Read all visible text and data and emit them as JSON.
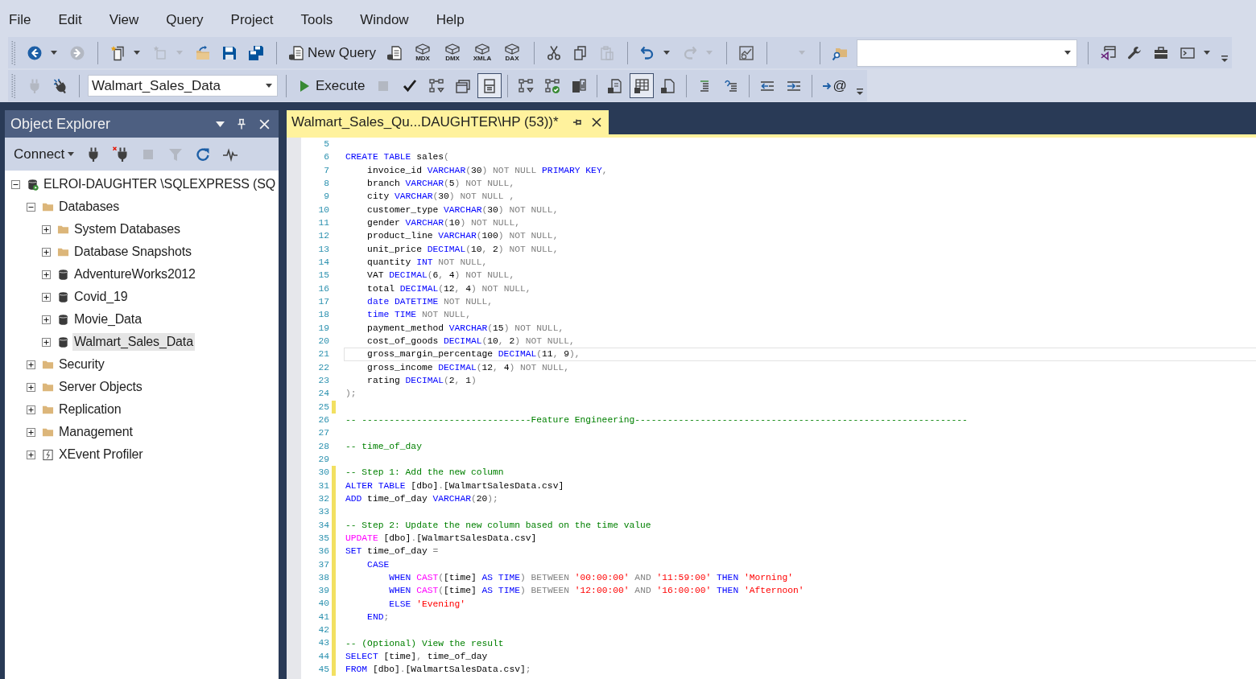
{
  "menu": [
    "File",
    "Edit",
    "View",
    "Query",
    "Project",
    "Tools",
    "Window",
    "Help"
  ],
  "toolbars": [
    {
      "items": [
        {
          "kind": "grip"
        },
        {
          "kind": "button",
          "disabled": false,
          "dropdown": true
        },
        {
          "kind": "button",
          "disabled": true,
          "dropdown": false
        },
        {
          "kind": "separator"
        },
        {
          "kind": "button",
          "disabled": false,
          "dropdown": true
        },
        {
          "kind": "button",
          "disabled": true,
          "dropdown": true
        },
        {
          "kind": "button",
          "disabled": false,
          "dropdown": false
        },
        {
          "kind": "button",
          "disabled": false,
          "dropdown": false
        },
        {
          "kind": "button",
          "disabled": false,
          "dropdown": false
        },
        {
          "kind": "separator"
        },
        {
          "kind": "text-button",
          "label": "New Query"
        },
        {
          "kind": "button",
          "disabled": false,
          "dropdown": false
        },
        {
          "kind": "button",
          "label": "MDX",
          "disabled": false,
          "dropdown": false
        },
        {
          "kind": "button",
          "label": "DMX",
          "disabled": false,
          "dropdown": false
        },
        {
          "kind": "button",
          "label": "XMLA",
          "disabled": false,
          "dropdown": false
        },
        {
          "kind": "button",
          "label": "DAX",
          "disabled": false,
          "dropdown": false
        },
        {
          "kind": "separator"
        },
        {
          "kind": "button",
          "disabled": false,
          "dropdown": false
        },
        {
          "kind": "button",
          "disabled": false,
          "dropdown": false
        },
        {
          "kind": "button",
          "disabled": true,
          "dropdown": false
        },
        {
          "kind": "separator"
        },
        {
          "kind": "button",
          "disabled": false,
          "dropdown": true
        },
        {
          "kind": "button",
          "disabled": true,
          "dropdown": true
        },
        {
          "kind": "separator"
        },
        {
          "kind": "button",
          "disabled": false,
          "dropdown": false
        },
        {
          "kind": "separator"
        },
        {
          "kind": "config-dropdown",
          "disabled": true
        },
        {
          "kind": "separator"
        },
        {
          "kind": "button",
          "disabled": false,
          "dropdown": false
        },
        {
          "kind": "search-combo"
        },
        {
          "kind": "separator"
        },
        {
          "kind": "button",
          "disabled": false,
          "dropdown": false
        },
        {
          "kind": "button",
          "disabled": false,
          "dropdown": false
        },
        {
          "kind": "button",
          "disabled": false,
          "dropdown": false
        },
        {
          "kind": "button",
          "disabled": false,
          "dropdown": true
        },
        {
          "kind": "overflow"
        }
      ]
    },
    {
      "items": [
        {
          "kind": "grip"
        },
        {
          "kind": "button",
          "disabled": true,
          "pressed": false
        },
        {
          "kind": "button",
          "disabled": false,
          "pressed": false
        },
        {
          "kind": "separator"
        },
        {
          "kind": "database-combo",
          "value": "Walmart_Sales_Data"
        },
        {
          "kind": "separator"
        },
        {
          "kind": "text-button",
          "label": "Execute"
        },
        {
          "kind": "button",
          "disabled": true,
          "pressed": false
        },
        {
          "kind": "button",
          "disabled": false,
          "pressed": false
        },
        {
          "kind": "button",
          "disabled": false,
          "pressed": false
        },
        {
          "kind": "button",
          "disabled": false,
          "pressed": false
        },
        {
          "kind": "button",
          "disabled": false,
          "pressed": true
        },
        {
          "kind": "separator"
        },
        {
          "kind": "button",
          "disabled": false,
          "pressed": false
        },
        {
          "kind": "button",
          "disabled": false,
          "pressed": false
        },
        {
          "kind": "button",
          "disabled": false,
          "pressed": false
        },
        {
          "kind": "separator"
        },
        {
          "kind": "button",
          "disabled": false,
          "pressed": false
        },
        {
          "kind": "button",
          "disabled": false,
          "pressed": true
        },
        {
          "kind": "button",
          "disabled": false,
          "pressed": false
        },
        {
          "kind": "separator"
        },
        {
          "kind": "button",
          "disabled": false,
          "pressed": false
        },
        {
          "kind": "button",
          "disabled": false,
          "pressed": false
        },
        {
          "kind": "separator"
        },
        {
          "kind": "button",
          "disabled": false,
          "pressed": false
        },
        {
          "kind": "button",
          "disabled": false,
          "pressed": false
        },
        {
          "kind": "separator"
        },
        {
          "kind": "button",
          "label": "@",
          "disabled": false,
          "pressed": false
        },
        {
          "kind": "overflow"
        }
      ]
    }
  ],
  "object_explorer": {
    "title": "Object Explorer",
    "toolbar": [
      {
        "kind": "connect",
        "label": "Connect"
      },
      {
        "kind": "button",
        "disabled": false
      },
      {
        "kind": "button",
        "disabled": false
      },
      {
        "kind": "button",
        "disabled": true
      },
      {
        "kind": "button",
        "disabled": true
      },
      {
        "kind": "button",
        "disabled": false
      },
      {
        "kind": "button",
        "disabled": false
      }
    ],
    "tree": [
      {
        "label": "ELROI-DAUGHTER \\SQLEXPRESS (SQ",
        "kind": "server",
        "expanded": true,
        "selected": false,
        "children": [
          {
            "label": "Databases",
            "kind": "folder",
            "expanded": true,
            "selected": false,
            "children": [
              {
                "label": "System Databases",
                "kind": "folder",
                "expanded": false,
                "selected": false
              },
              {
                "label": "Database Snapshots",
                "kind": "folder",
                "expanded": false,
                "selected": false
              },
              {
                "label": "AdventureWorks2012",
                "kind": "database",
                "expanded": false,
                "selected": false
              },
              {
                "label": "Covid_19",
                "kind": "database",
                "expanded": false,
                "selected": false
              },
              {
                "label": "Movie_Data",
                "kind": "database",
                "expanded": false,
                "selected": false
              },
              {
                "label": "Walmart_Sales_Data",
                "kind": "database",
                "expanded": false,
                "selected": true
              }
            ]
          },
          {
            "label": "Security",
            "kind": "folder",
            "expanded": false,
            "selected": false
          },
          {
            "label": "Server Objects",
            "kind": "folder",
            "expanded": false,
            "selected": false
          },
          {
            "label": "Replication",
            "kind": "folder",
            "expanded": false,
            "selected": false
          },
          {
            "label": "Management",
            "kind": "folder",
            "expanded": false,
            "selected": false
          },
          {
            "label": "XEvent Profiler",
            "kind": "profiler",
            "expanded": false,
            "selected": false
          }
        ]
      }
    ]
  },
  "editor": {
    "tabs": [
      {
        "label": "Walmart_Sales_Qu...DAUGHTER\\HP (53))*",
        "selected": true
      }
    ],
    "lines": [
      {
        "number": "5",
        "changed": false,
        "current": false
      },
      {
        "number": "6",
        "changed": false,
        "current": false,
        "tokens": [
          {
            "kind": "keyword",
            "text": "CREATE TABLE"
          },
          {
            "kind": "identifier",
            "text": " sales"
          },
          {
            "kind": "operator",
            "text": "("
          }
        ]
      },
      {
        "number": "7",
        "changed": false,
        "current": false,
        "tokens": [
          {
            "kind": "identifier",
            "text": "    invoice_id "
          },
          {
            "kind": "keyword",
            "text": "VARCHAR"
          },
          {
            "kind": "operator",
            "text": "("
          },
          {
            "kind": "identifier",
            "text": "30"
          },
          {
            "kind": "operator",
            "text": ") NOT NULL "
          },
          {
            "kind": "keyword",
            "text": "PRIMARY KEY"
          },
          {
            "kind": "operator",
            "text": ","
          }
        ]
      },
      {
        "number": "8",
        "changed": false,
        "current": false,
        "tokens": [
          {
            "kind": "identifier",
            "text": "    branch "
          },
          {
            "kind": "keyword",
            "text": "VARCHAR"
          },
          {
            "kind": "operator",
            "text": "("
          },
          {
            "kind": "identifier",
            "text": "5"
          },
          {
            "kind": "operator",
            "text": ") NOT NULL,"
          }
        ]
      },
      {
        "number": "9",
        "changed": false,
        "current": false,
        "tokens": [
          {
            "kind": "identifier",
            "text": "    city "
          },
          {
            "kind": "keyword",
            "text": "VARCHAR"
          },
          {
            "kind": "operator",
            "text": "("
          },
          {
            "kind": "identifier",
            "text": "30"
          },
          {
            "kind": "operator",
            "text": ") NOT NULL ,"
          }
        ]
      },
      {
        "number": "10",
        "changed": false,
        "current": false,
        "tokens": [
          {
            "kind": "identifier",
            "text": "    customer_type "
          },
          {
            "kind": "keyword",
            "text": "VARCHAR"
          },
          {
            "kind": "operator",
            "text": "("
          },
          {
            "kind": "identifier",
            "text": "30"
          },
          {
            "kind": "operator",
            "text": ") NOT NULL,"
          }
        ]
      },
      {
        "number": "11",
        "changed": false,
        "current": false,
        "tokens": [
          {
            "kind": "identifier",
            "text": "    gender "
          },
          {
            "kind": "keyword",
            "text": "VARCHAR"
          },
          {
            "kind": "operator",
            "text": "("
          },
          {
            "kind": "identifier",
            "text": "10"
          },
          {
            "kind": "operator",
            "text": ") NOT NULL,"
          }
        ]
      },
      {
        "number": "12",
        "changed": false,
        "current": false,
        "tokens": [
          {
            "kind": "identifier",
            "text": "    product_line "
          },
          {
            "kind": "keyword",
            "text": "VARCHAR"
          },
          {
            "kind": "operator",
            "text": "("
          },
          {
            "kind": "identifier",
            "text": "100"
          },
          {
            "kind": "operator",
            "text": ") NOT NULL,"
          }
        ]
      },
      {
        "number": "13",
        "changed": false,
        "current": false,
        "tokens": [
          {
            "kind": "identifier",
            "text": "    unit_price "
          },
          {
            "kind": "keyword",
            "text": "DECIMAL"
          },
          {
            "kind": "operator",
            "text": "("
          },
          {
            "kind": "identifier",
            "text": "10"
          },
          {
            "kind": "operator",
            "text": ", "
          },
          {
            "kind": "identifier",
            "text": "2"
          },
          {
            "kind": "operator",
            "text": ") NOT NULL,"
          }
        ]
      },
      {
        "number": "14",
        "changed": false,
        "current": false,
        "tokens": [
          {
            "kind": "identifier",
            "text": "    quantity "
          },
          {
            "kind": "keyword",
            "text": "INT"
          },
          {
            "kind": "operator",
            "text": " NOT NULL,"
          }
        ]
      },
      {
        "number": "15",
        "changed": false,
        "current": false,
        "tokens": [
          {
            "kind": "identifier",
            "text": "    VAT "
          },
          {
            "kind": "keyword",
            "text": "DECIMAL"
          },
          {
            "kind": "operator",
            "text": "("
          },
          {
            "kind": "identifier",
            "text": "6"
          },
          {
            "kind": "operator",
            "text": ", "
          },
          {
            "kind": "identifier",
            "text": "4"
          },
          {
            "kind": "operator",
            "text": ") NOT NULL,"
          }
        ]
      },
      {
        "number": "16",
        "changed": false,
        "current": false,
        "tokens": [
          {
            "kind": "identifier",
            "text": "    total "
          },
          {
            "kind": "keyword",
            "text": "DECIMAL"
          },
          {
            "kind": "operator",
            "text": "("
          },
          {
            "kind": "identifier",
            "text": "12"
          },
          {
            "kind": "operator",
            "text": ", "
          },
          {
            "kind": "identifier",
            "text": "4"
          },
          {
            "kind": "operator",
            "text": ") NOT NULL,"
          }
        ]
      },
      {
        "number": "17",
        "changed": false,
        "current": false,
        "tokens": [
          {
            "kind": "keyword",
            "text": "    date DATETIME"
          },
          {
            "kind": "operator",
            "text": " NOT NULL,"
          }
        ]
      },
      {
        "number": "18",
        "changed": false,
        "current": false,
        "tokens": [
          {
            "kind": "keyword",
            "text": "    time TIME"
          },
          {
            "kind": "operator",
            "text": " NOT NULL,"
          }
        ]
      },
      {
        "number": "19",
        "changed": false,
        "current": false,
        "tokens": [
          {
            "kind": "identifier",
            "text": "    payment_method "
          },
          {
            "kind": "keyword",
            "text": "VARCHAR"
          },
          {
            "kind": "operator",
            "text": "("
          },
          {
            "kind": "identifier",
            "text": "15"
          },
          {
            "kind": "operator",
            "text": ") NOT NULL,"
          }
        ]
      },
      {
        "number": "20",
        "changed": false,
        "current": false,
        "tokens": [
          {
            "kind": "identifier",
            "text": "    cost_of_goods "
          },
          {
            "kind": "keyword",
            "text": "DECIMAL"
          },
          {
            "kind": "operator",
            "text": "("
          },
          {
            "kind": "identifier",
            "text": "10"
          },
          {
            "kind": "operator",
            "text": ", "
          },
          {
            "kind": "identifier",
            "text": "2"
          },
          {
            "kind": "operator",
            "text": ") NOT NULL,"
          }
        ]
      },
      {
        "number": "21",
        "changed": false,
        "current": true,
        "tokens": [
          {
            "kind": "identifier",
            "text": "    gross_margin_percentage "
          },
          {
            "kind": "keyword",
            "text": "DECIMAL"
          },
          {
            "kind": "operator",
            "text": "("
          },
          {
            "kind": "identifier",
            "text": "11"
          },
          {
            "kind": "operator",
            "text": ", "
          },
          {
            "kind": "identifier",
            "text": "9"
          },
          {
            "kind": "operator",
            "text": "),"
          }
        ]
      },
      {
        "number": "22",
        "changed": false,
        "current": false,
        "tokens": [
          {
            "kind": "identifier",
            "text": "    gross_income "
          },
          {
            "kind": "keyword",
            "text": "DECIMAL"
          },
          {
            "kind": "operator",
            "text": "("
          },
          {
            "kind": "identifier",
            "text": "12"
          },
          {
            "kind": "operator",
            "text": ", "
          },
          {
            "kind": "identifier",
            "text": "4"
          },
          {
            "kind": "operator",
            "text": ") NOT NULL,"
          }
        ]
      },
      {
        "number": "23",
        "changed": false,
        "current": false,
        "tokens": [
          {
            "kind": "identifier",
            "text": "    rating "
          },
          {
            "kind": "keyword",
            "text": "DECIMAL"
          },
          {
            "kind": "operator",
            "text": "("
          },
          {
            "kind": "identifier",
            "text": "2"
          },
          {
            "kind": "operator",
            "text": ", "
          },
          {
            "kind": "identifier",
            "text": "1"
          },
          {
            "kind": "operator",
            "text": ")"
          }
        ]
      },
      {
        "number": "24",
        "changed": false,
        "current": false,
        "tokens": [
          {
            "kind": "operator",
            "text": ");"
          }
        ]
      },
      {
        "number": "25",
        "changed": true,
        "current": false
      },
      {
        "number": "26",
        "changed": false,
        "current": false,
        "tokens": [
          {
            "kind": "comment",
            "text": "-- -------------------------------Feature Engineering-------------------------------------------------------------"
          }
        ]
      },
      {
        "number": "27",
        "changed": false,
        "current": false
      },
      {
        "number": "28",
        "changed": false,
        "current": false,
        "tokens": [
          {
            "kind": "comment",
            "text": "-- time_of_day"
          }
        ]
      },
      {
        "number": "29",
        "changed": false,
        "current": false
      },
      {
        "number": "30",
        "changed": true,
        "current": false,
        "tokens": [
          {
            "kind": "comment",
            "text": "-- Step 1: Add the new column"
          }
        ]
      },
      {
        "number": "31",
        "changed": true,
        "current": false,
        "tokens": [
          {
            "kind": "keyword",
            "text": "ALTER TABLE"
          },
          {
            "kind": "identifier",
            "text": " [dbo]"
          },
          {
            "kind": "operator",
            "text": "."
          },
          {
            "kind": "identifier",
            "text": "[WalmartSalesData.csv]"
          }
        ]
      },
      {
        "number": "32",
        "changed": true,
        "current": false,
        "tokens": [
          {
            "kind": "keyword",
            "text": "ADD"
          },
          {
            "kind": "identifier",
            "text": " time_of_day "
          },
          {
            "kind": "keyword",
            "text": "VARCHAR"
          },
          {
            "kind": "operator",
            "text": "("
          },
          {
            "kind": "identifier",
            "text": "20"
          },
          {
            "kind": "operator",
            "text": ");"
          }
        ]
      },
      {
        "number": "33",
        "changed": true,
        "current": false
      },
      {
        "number": "34",
        "changed": true,
        "current": false,
        "tokens": [
          {
            "kind": "comment",
            "text": "-- Step 2: Update the new column based on the time value"
          }
        ]
      },
      {
        "number": "35",
        "changed": true,
        "current": false,
        "tokens": [
          {
            "kind": "function",
            "text": "UPDATE"
          },
          {
            "kind": "identifier",
            "text": " [dbo]"
          },
          {
            "kind": "operator",
            "text": "."
          },
          {
            "kind": "identifier",
            "text": "[WalmartSalesData.csv]"
          }
        ]
      },
      {
        "number": "36",
        "changed": true,
        "current": false,
        "tokens": [
          {
            "kind": "keyword",
            "text": "SET"
          },
          {
            "kind": "identifier",
            "text": " time_of_day "
          },
          {
            "kind": "operator",
            "text": "="
          }
        ]
      },
      {
        "number": "37",
        "changed": true,
        "current": false,
        "tokens": [
          {
            "kind": "keyword",
            "text": "    CASE"
          }
        ]
      },
      {
        "number": "38",
        "changed": true,
        "current": false,
        "tokens": [
          {
            "kind": "keyword",
            "text": "        WHEN "
          },
          {
            "kind": "function",
            "text": "CAST"
          },
          {
            "kind": "operator",
            "text": "("
          },
          {
            "kind": "identifier",
            "text": "[time] "
          },
          {
            "kind": "keyword",
            "text": "AS TIME"
          },
          {
            "kind": "operator",
            "text": ") BETWEEN "
          },
          {
            "kind": "string",
            "text": "'00:00:00'"
          },
          {
            "kind": "operator",
            "text": " AND "
          },
          {
            "kind": "string",
            "text": "'11:59:00'"
          },
          {
            "kind": "keyword",
            "text": " THEN "
          },
          {
            "kind": "string",
            "text": "'Morning'"
          }
        ]
      },
      {
        "number": "39",
        "changed": true,
        "current": false,
        "tokens": [
          {
            "kind": "keyword",
            "text": "        WHEN "
          },
          {
            "kind": "function",
            "text": "CAST"
          },
          {
            "kind": "operator",
            "text": "("
          },
          {
            "kind": "identifier",
            "text": "[time] "
          },
          {
            "kind": "keyword",
            "text": "AS TIME"
          },
          {
            "kind": "operator",
            "text": ") BETWEEN "
          },
          {
            "kind": "string",
            "text": "'12:00:00'"
          },
          {
            "kind": "operator",
            "text": " AND "
          },
          {
            "kind": "string",
            "text": "'16:00:00'"
          },
          {
            "kind": "keyword",
            "text": " THEN "
          },
          {
            "kind": "string",
            "text": "'Afternoon'"
          }
        ]
      },
      {
        "number": "40",
        "changed": true,
        "current": false,
        "tokens": [
          {
            "kind": "keyword",
            "text": "        ELSE "
          },
          {
            "kind": "string",
            "text": "'Evening'"
          }
        ]
      },
      {
        "number": "41",
        "changed": true,
        "current": false,
        "tokens": [
          {
            "kind": "keyword",
            "text": "    END"
          },
          {
            "kind": "operator",
            "text": ";"
          }
        ]
      },
      {
        "number": "42",
        "changed": true,
        "current": false
      },
      {
        "number": "43",
        "changed": true,
        "current": false,
        "tokens": [
          {
            "kind": "comment",
            "text": "-- (Optional) View the result"
          }
        ]
      },
      {
        "number": "44",
        "changed": true,
        "current": false,
        "tokens": [
          {
            "kind": "keyword",
            "text": "SELECT"
          },
          {
            "kind": "identifier",
            "text": " [time]"
          },
          {
            "kind": "operator",
            "text": ","
          },
          {
            "kind": "identifier",
            "text": " time_of_day"
          }
        ]
      },
      {
        "number": "45",
        "changed": true,
        "current": false,
        "tokens": [
          {
            "kind": "keyword",
            "text": "FROM"
          },
          {
            "kind": "identifier",
            "text": " [dbo]"
          },
          {
            "kind": "operator",
            "text": "."
          },
          {
            "kind": "identifier",
            "text": "[WalmartSalesData.csv]"
          },
          {
            "kind": "operator",
            "text": ";"
          }
        ]
      }
    ]
  }
}
